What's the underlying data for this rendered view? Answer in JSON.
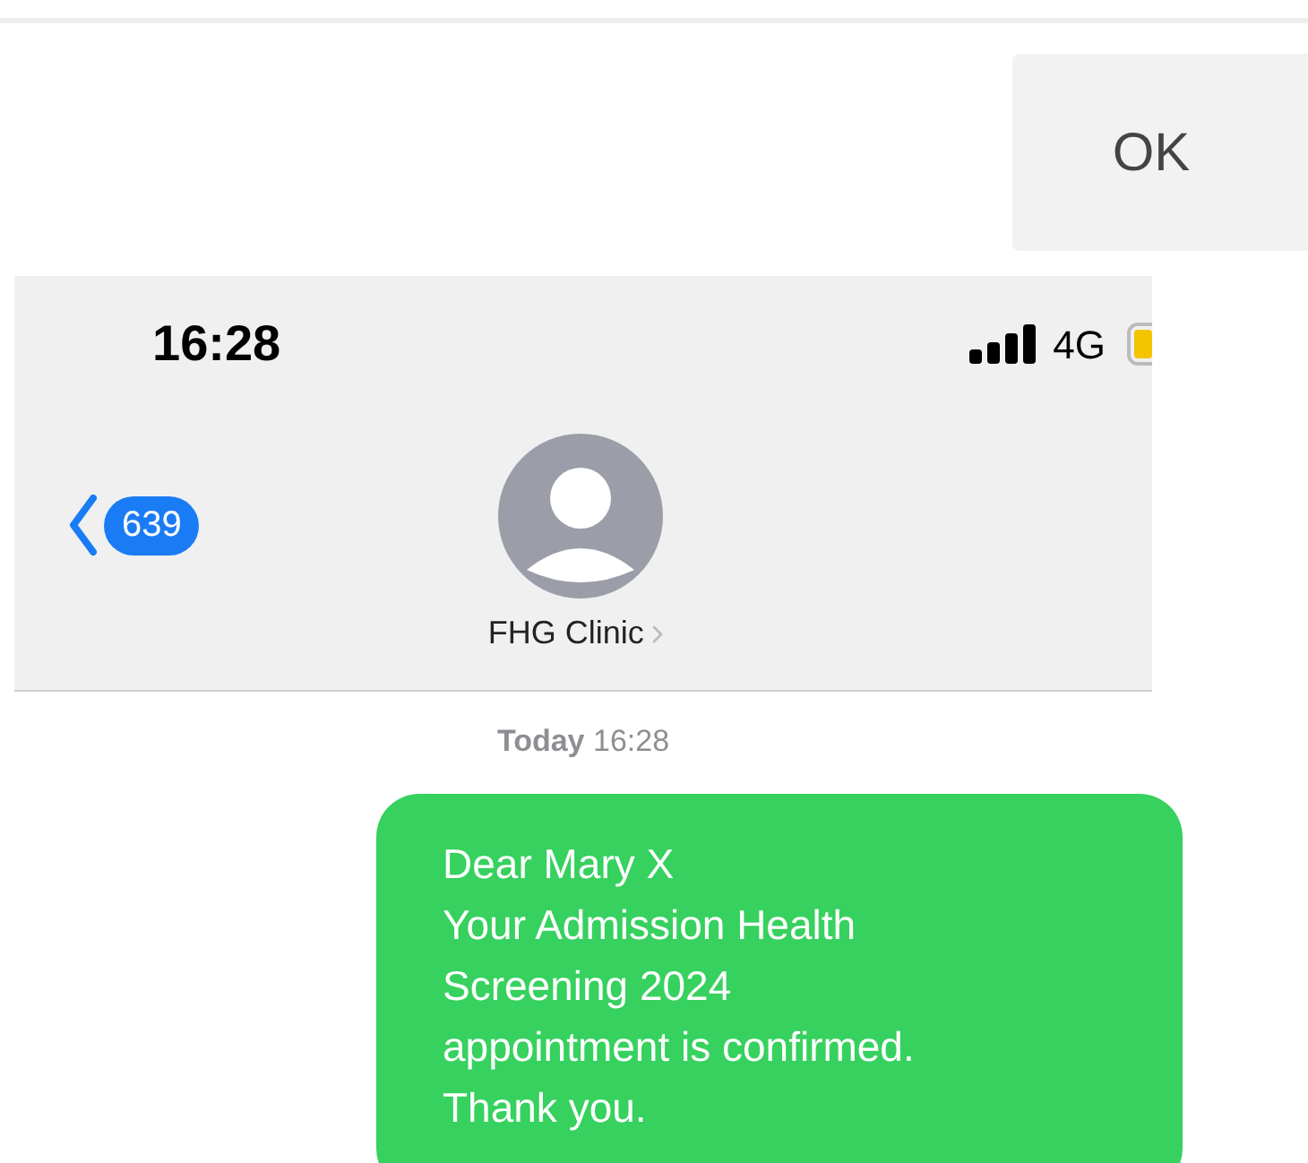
{
  "dialog": {
    "ok_button": "OK"
  },
  "status_bar": {
    "time": "16:28",
    "network": "4G"
  },
  "conversation_header": {
    "unread_count": "639",
    "contact_name": "FHG Clinic"
  },
  "messages": [
    {
      "timestamp": "Today 16:28",
      "text": "Dear Mary X\nYour Admission Health\nScreening 2024\nappointment is confirmed.\nThank you."
    }
  ]
}
